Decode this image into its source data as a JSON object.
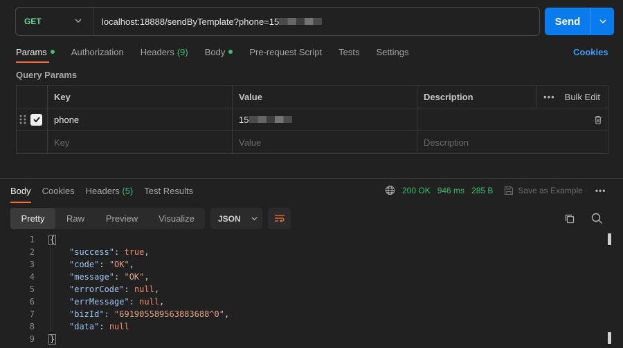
{
  "request": {
    "method": "GET",
    "url": "localhost:18888/sendByTemplate?phone=15",
    "send_label": "Send"
  },
  "tabs": [
    {
      "label": "Params"
    },
    {
      "label": "Authorization"
    },
    {
      "label": "Headers",
      "count": "(9)"
    },
    {
      "label": "Body"
    },
    {
      "label": "Pre-request Script"
    },
    {
      "label": "Tests"
    },
    {
      "label": "Settings"
    }
  ],
  "cookies_label": "Cookies",
  "query_params": {
    "title": "Query Params",
    "headers": {
      "key": "Key",
      "value": "Value",
      "description": "Description",
      "bulk_edit": "Bulk Edit"
    },
    "rows": [
      {
        "key": "phone",
        "value": "15",
        "description": ""
      }
    ],
    "placeholder": {
      "key": "Key",
      "value": "Value",
      "description": "Description"
    }
  },
  "response": {
    "tabs": [
      {
        "label": "Body"
      },
      {
        "label": "Cookies"
      },
      {
        "label": "Headers",
        "count": "(5)"
      },
      {
        "label": "Test Results"
      }
    ],
    "status": "200 OK",
    "time": "946 ms",
    "size": "285 B",
    "save_example": "Save as Example",
    "views": [
      "Pretty",
      "Raw",
      "Preview",
      "Visualize"
    ],
    "format": "JSON",
    "line_numbers": [
      "1",
      "2",
      "3",
      "4",
      "5",
      "6",
      "7",
      "8",
      "9"
    ],
    "open_brace": "{",
    "close_brace": "}",
    "fields": [
      {
        "key": "\"success\"",
        "value": "true",
        "type": "kw",
        "comma": ","
      },
      {
        "key": "\"code\"",
        "value": "\"OK\"",
        "type": "str",
        "comma": ","
      },
      {
        "key": "\"message\"",
        "value": "\"OK\"",
        "type": "str",
        "comma": ","
      },
      {
        "key": "\"errorCode\"",
        "value": "null",
        "type": "kw",
        "comma": ","
      },
      {
        "key": "\"errMessage\"",
        "value": "null",
        "type": "kw",
        "comma": ","
      },
      {
        "key": "\"bizId\"",
        "value": "\"691905589563883688^0\"",
        "type": "str",
        "comma": ","
      },
      {
        "key": "\"data\"",
        "value": "null",
        "type": "kw",
        "comma": ""
      }
    ]
  },
  "colors": {
    "accent": "#ff6c37",
    "send": "#097bed",
    "success": "#3fbf6f"
  }
}
